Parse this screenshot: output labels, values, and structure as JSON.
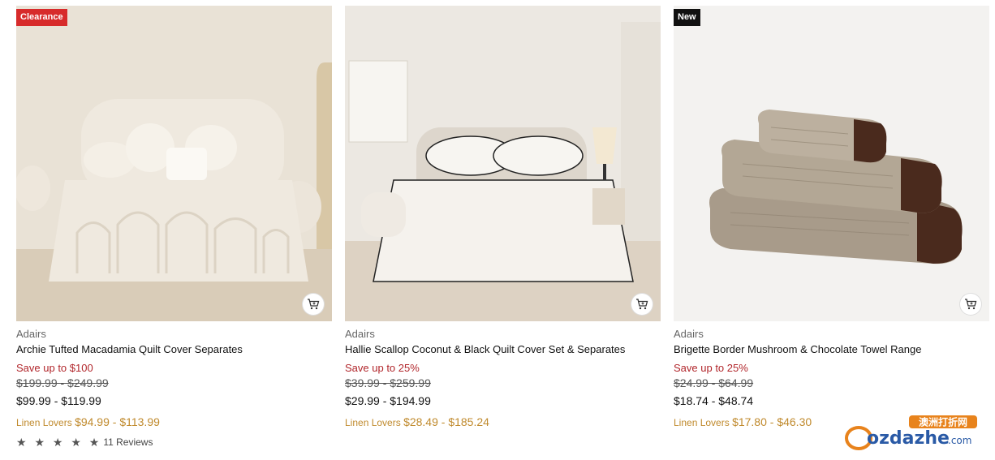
{
  "products": [
    {
      "badge": "Clearance",
      "brand": "Adairs",
      "title": "Archie Tufted Macadamia Quilt Cover Separates",
      "save": "Save up to $100",
      "was": "$199.99 - $249.99",
      "now": "$99.99 - $119.99",
      "member_label": "Linen Lovers",
      "member_price": "$94.99 - $113.99",
      "stars": "★ ★ ★ ★ ★",
      "reviews": "11 Reviews"
    },
    {
      "brand": "Adairs",
      "title": "Hallie Scallop Coconut & Black Quilt Cover Set & Separates",
      "save": "Save up to 25%",
      "was": "$39.99 - $259.99",
      "now": "$29.99 - $194.99",
      "member_label": "Linen Lovers",
      "member_price": "$28.49 - $185.24"
    },
    {
      "badge": "New",
      "brand": "Adairs",
      "title": "Brigette Border Mushroom & Chocolate Towel Range",
      "save": "Save up to 25%",
      "was": "$24.99 - $64.99",
      "now": "$18.74 - $48.74",
      "member_label": "Linen Lovers",
      "member_price": "$17.80 - $46.30"
    }
  ],
  "watermark": {
    "chinese": "澳洲打折网",
    "domain": "ozdazhe",
    "tld": ".com"
  },
  "colors": {
    "clearance_badge": "#d72b2b",
    "new_badge": "#111111",
    "save_text": "#b1262b",
    "member_text": "#c08a2d"
  }
}
